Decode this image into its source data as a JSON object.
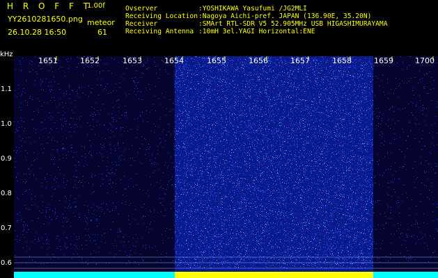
{
  "header": {
    "logo": "H R O F F T",
    "version": "1.00f",
    "filename": "YY2610281650.png",
    "timestamp": "26.10.28 16:50",
    "meteor_label": "meteor",
    "meteor_count": "61"
  },
  "meta": [
    {
      "label": "Ovserver",
      "value": ":YOSHIKAWA Yasufumi /JG2MLI"
    },
    {
      "label": "Receiving Location",
      "value": ":Nagoya Aichi-pref. JAPAN (136.90E, 35.20N)"
    },
    {
      "label": "Receiver",
      "value": ":SMArt RTL-SDR V5 52.905MHz USB HIGASHIMURAYAMA"
    },
    {
      "label": "Receiving Antenna",
      "value": ":10mH 3el.YAGI Horizontal:ENE"
    }
  ],
  "spectrogram": {
    "yunit": "kHz",
    "time_labels": [
      "1651",
      "1652",
      "1653",
      "1654",
      "1655",
      "1656",
      "1657",
      "1658",
      "1659",
      "1700"
    ],
    "freq_labels": [
      "1.1",
      "1.0",
      "0.9",
      "0.8",
      "0.7",
      "0.6"
    ],
    "colors": {
      "background": "#04042e",
      "noise": "#1f3cff",
      "burst": "#2bb8ff",
      "baseline": "#00ffff",
      "highlight": "#ffff00"
    }
  }
}
